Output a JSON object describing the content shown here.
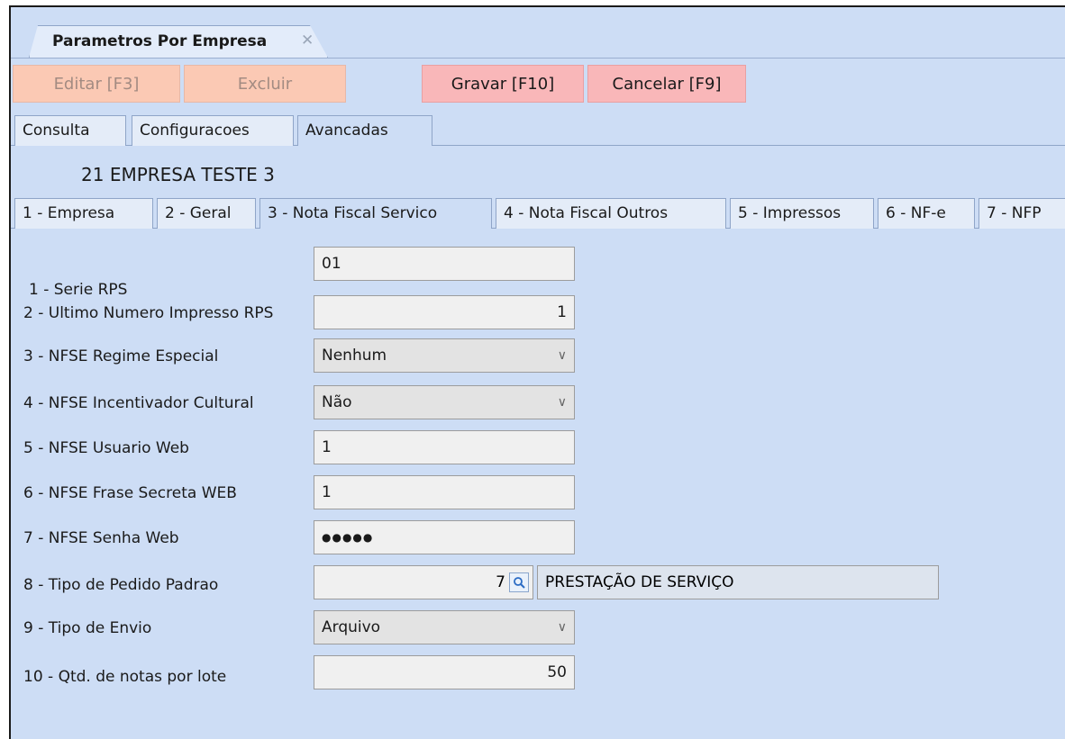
{
  "document_tab": {
    "title": "Parametros Por Empresa",
    "close": "✕"
  },
  "toolbar": {
    "edit": "Editar [F3]",
    "delete": "Excluir",
    "save": "Gravar [F10]",
    "cancel": "Cancelar [F9]"
  },
  "view_tabs": [
    "Consulta",
    "Configuracoes",
    "Avancadas"
  ],
  "company": {
    "code": "21",
    "name": "EMPRESA TESTE 3"
  },
  "section_tabs": [
    "1 - Empresa",
    "2 - Geral",
    "3 - Nota Fiscal Servico",
    "4 - Nota Fiscal Outros",
    "5 - Impressos",
    "6 - NF-e",
    "7 - NFP"
  ],
  "form": {
    "serie_rps": {
      "label": "1 - Serie RPS",
      "value": "01"
    },
    "ultimo_numero": {
      "label": "2 - Ultimo Numero Impresso RPS",
      "value": "1"
    },
    "regime_especial": {
      "label": "3 - NFSE Regime Especial",
      "value": "Nenhum"
    },
    "incentivador": {
      "label": "4 - NFSE Incentivador Cultural",
      "value": "Não"
    },
    "usuario_web": {
      "label": "5 - NFSE Usuario Web",
      "value": "1"
    },
    "frase_secreta": {
      "label": "6 - NFSE Frase Secreta WEB",
      "value": "1"
    },
    "senha_web": {
      "label": "7 - NFSE Senha Web",
      "value": "●●●●●"
    },
    "tipo_pedido": {
      "label": "8 - Tipo de Pedido Padrao",
      "value": "7",
      "description": "PRESTAÇÃO DE SERVIÇO"
    },
    "tipo_envio": {
      "label": "9 - Tipo de Envio",
      "value": "Arquivo"
    },
    "qtd_notas": {
      "label": "10 - Qtd. de notas por lote",
      "value": "50"
    }
  },
  "colors": {
    "background": "#cdddf5",
    "disabled_button": "#fbc9b4",
    "active_button": "#f9b7b9"
  }
}
